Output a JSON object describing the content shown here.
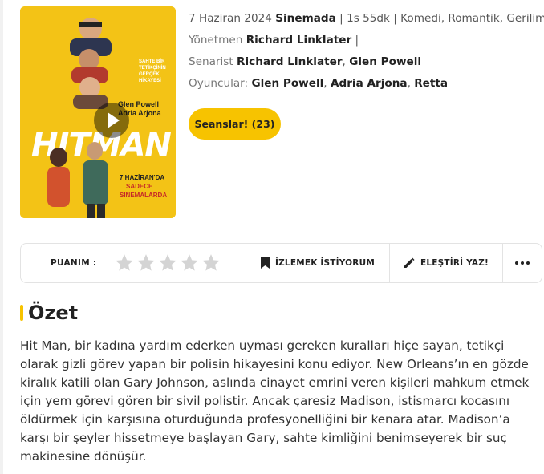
{
  "poster": {
    "title_text": "HITMAN",
    "names_text": "Glen Powell\nAdria Arjona",
    "tagline_text": "SAHTE BİR TETİKÇİNİN GERÇEK HİKAYESİ",
    "release_text": "7 HAZİRAN'DA SADECE SİNEMALARDA",
    "bg_color": "#f3c316"
  },
  "meta": {
    "date": "7 Haziran 2024",
    "status": "Sinemada",
    "separator": "|",
    "duration": "1s 55dk",
    "genres": "Komedi, Romantik, Gerilim"
  },
  "director": {
    "label": "Yönetmen",
    "name": "Richard Linklater",
    "trail": "|"
  },
  "writers": {
    "label": "Senarist",
    "names": [
      "Richard Linklater",
      "Glen Powell"
    ]
  },
  "cast": {
    "label": "Oyuncular:",
    "names": [
      "Glen Powell",
      "Adria Arjona",
      "Retta"
    ]
  },
  "seans_button": "Seanslar! (23)",
  "actions": {
    "rating_label": "PUANIM :",
    "star_count": 5,
    "rating_value": 0,
    "watch_label": "İZLEMEK İSTİYORUM",
    "review_label": "ELEŞTİRİ YAZ!",
    "more_icon": "more-dots-icon"
  },
  "summary": {
    "title": "Özet",
    "text": "Hit Man, bir kadına yardım ederken uyması gereken kuralları hiçe sayan, tetikçi olarak gizli görev yapan bir polisin hikayesini konu ediyor. New Orleans’ın en gözde kiralık katili olan Gary Johnson, aslında cinayet emrini veren kişileri mahkum etmek için yem görevi gören bir sivil polistir. Ancak çaresiz Madison, istismarcı kocasını öldürmek için karşısına oturduğunda profesyonelliğini bir kenara atar. Madison’a karşı bir şeyler hissetmeye başlayan Gary, sahte kimliğini benimseyerek bir suç makinesine dönüşür."
  },
  "colors": {
    "accent": "#f7c300",
    "star_empty": "#d4d4d4",
    "text_dark": "#222222"
  }
}
